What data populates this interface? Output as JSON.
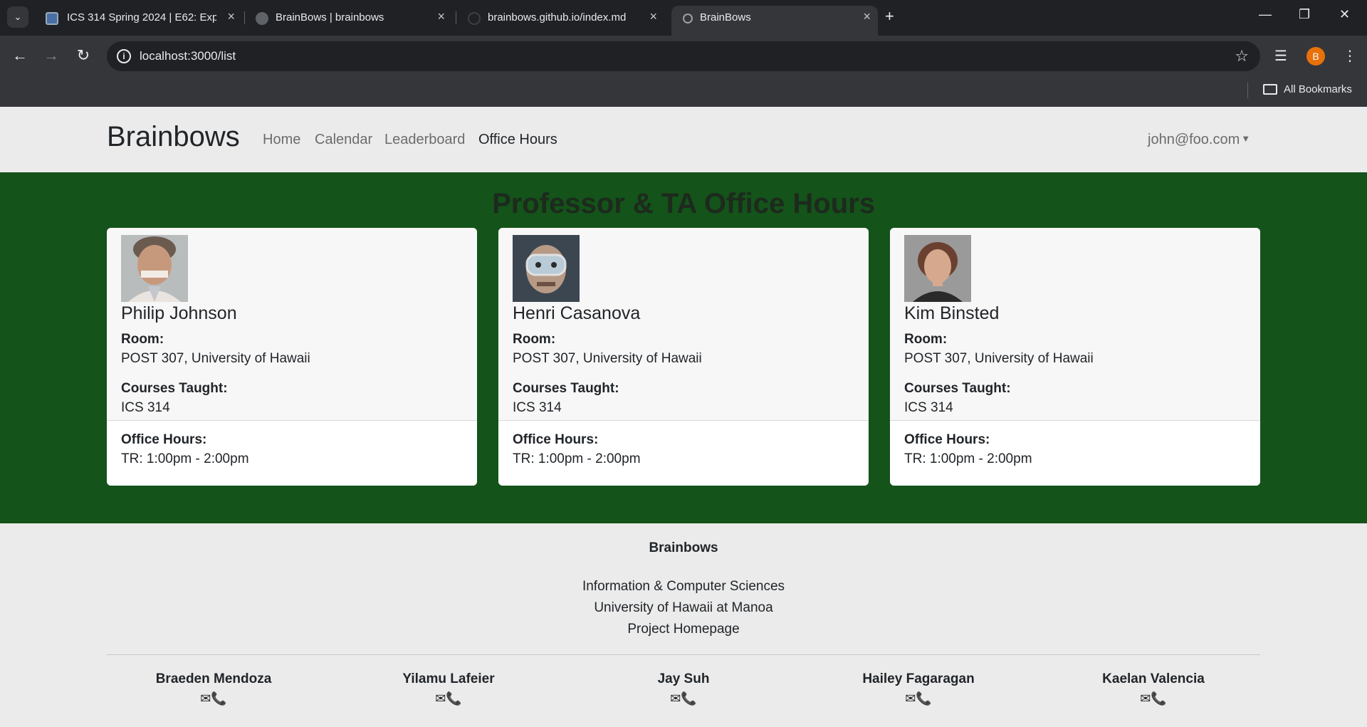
{
  "browser": {
    "tabs": [
      {
        "title": "ICS 314 Spring 2024 | E62: Expe",
        "active": false
      },
      {
        "title": "BrainBows | brainbows",
        "active": false
      },
      {
        "title": "brainbows.github.io/index.md",
        "active": false
      },
      {
        "title": "BrainBows",
        "active": true
      }
    ],
    "url": "localhost:3000/list",
    "profile_initial": "B",
    "bookmarks_label": "All Bookmarks"
  },
  "navbar": {
    "brand": "Brainbows",
    "links": [
      "Home",
      "Calendar",
      "Leaderboard",
      "Office Hours"
    ],
    "active_link": "Office Hours",
    "user": "john@foo.com"
  },
  "hero": {
    "title": "Professor & TA Office Hours",
    "bg_color": "#14531a"
  },
  "cards": [
    {
      "name": "Philip Johnson",
      "room_label": "Room:",
      "room": "POST 307, University of Hawaii",
      "courses_label": "Courses Taught:",
      "courses": "ICS 314",
      "hours_label": "Office Hours:",
      "hours": "TR: 1:00pm - 2:00pm"
    },
    {
      "name": "Henri Casanova",
      "room_label": "Room:",
      "room": "POST 307, University of Hawaii",
      "courses_label": "Courses Taught:",
      "courses": "ICS 314",
      "hours_label": "Office Hours:",
      "hours": "TR: 1:00pm - 2:00pm"
    },
    {
      "name": "Kim Binsted",
      "room_label": "Room:",
      "room": "POST 307, University of Hawaii",
      "courses_label": "Courses Taught:",
      "courses": "ICS 314",
      "hours_label": "Office Hours:",
      "hours": "TR: 1:00pm - 2:00pm"
    }
  ],
  "footer": {
    "title": "Brainbows",
    "lines": [
      "Information & Computer Sciences",
      "University of Hawaii at Manoa",
      "Project Homepage"
    ],
    "members": [
      "Braeden Mendoza",
      "Yilamu Lafeier",
      "Jay Suh",
      "Hailey Fagaragan",
      "Kaelan Valencia"
    ],
    "member_icons": "✉📞"
  }
}
